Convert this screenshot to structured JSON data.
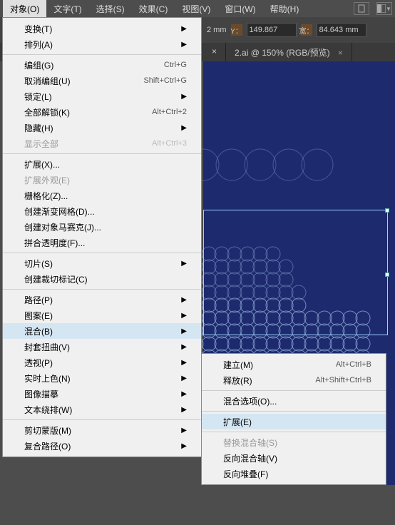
{
  "menubar": {
    "items": [
      "对象(O)",
      "文字(T)",
      "选择(S)",
      "效果(C)",
      "视图(V)",
      "窗口(W)",
      "帮助(H)"
    ]
  },
  "toolbar": {
    "val1_suffix": "2 mm",
    "y_label": "Y：",
    "y_value": "149.867 ",
    "w_label": "宽：",
    "w_value": "84.643 mm"
  },
  "tabs": {
    "tab1_label": "2.ai @ 150% (RGB/预览)",
    "close": "×"
  },
  "menu": {
    "sec1": [
      {
        "label": "变换(T)",
        "arrow": true
      },
      {
        "label": "排列(A)",
        "arrow": true
      }
    ],
    "sec2": [
      {
        "label": "编组(G)",
        "shortcut": "Ctrl+G"
      },
      {
        "label": "取消编组(U)",
        "shortcut": "Shift+Ctrl+G"
      },
      {
        "label": "锁定(L)",
        "arrow": true
      },
      {
        "label": "全部解锁(K)",
        "shortcut": "Alt+Ctrl+2"
      },
      {
        "label": "隐藏(H)",
        "arrow": true
      },
      {
        "label": "显示全部",
        "shortcut": "Alt+Ctrl+3",
        "disabled": true
      }
    ],
    "sec3": [
      {
        "label": "扩展(X)..."
      },
      {
        "label": "扩展外观(E)",
        "disabled": true
      },
      {
        "label": "栅格化(Z)..."
      },
      {
        "label": "创建渐变网格(D)..."
      },
      {
        "label": "创建对象马赛克(J)..."
      },
      {
        "label": "拼合透明度(F)..."
      }
    ],
    "sec4": [
      {
        "label": "切片(S)",
        "arrow": true
      },
      {
        "label": "创建裁切标记(C)"
      }
    ],
    "sec5": [
      {
        "label": "路径(P)",
        "arrow": true
      },
      {
        "label": "图案(E)",
        "arrow": true
      },
      {
        "label": "混合(B)",
        "arrow": true,
        "highlight": true
      },
      {
        "label": "封套扭曲(V)",
        "arrow": true
      },
      {
        "label": "透视(P)",
        "arrow": true
      },
      {
        "label": "实时上色(N)",
        "arrow": true
      },
      {
        "label": "图像描摹",
        "arrow": true
      },
      {
        "label": "文本绕排(W)",
        "arrow": true
      }
    ],
    "sec6": [
      {
        "label": "剪切蒙版(M)",
        "arrow": true
      },
      {
        "label": "复合路径(O)",
        "arrow": true
      }
    ]
  },
  "submenu": {
    "items": [
      {
        "label": "建立(M)",
        "shortcut": "Alt+Ctrl+B"
      },
      {
        "label": "释放(R)",
        "shortcut": "Alt+Shift+Ctrl+B"
      }
    ],
    "sec2": [
      {
        "label": "混合选项(O)..."
      }
    ],
    "sec3": [
      {
        "label": "扩展(E)",
        "highlight": true
      }
    ],
    "sec4": [
      {
        "label": "替换混合轴(S)",
        "disabled": true
      },
      {
        "label": "反向混合轴(V)"
      },
      {
        "label": "反向堆叠(F)"
      }
    ]
  }
}
